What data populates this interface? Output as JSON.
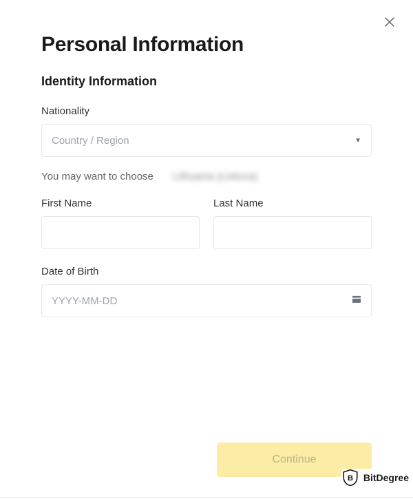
{
  "header": {
    "title": "Personal Information",
    "sectionTitle": "Identity Information"
  },
  "nationality": {
    "label": "Nationality",
    "placeholder": "Country / Region"
  },
  "hint": {
    "text": "You may want to choose",
    "suggestion": "Lithuania (Lietuva)"
  },
  "firstName": {
    "label": "First Name",
    "value": ""
  },
  "lastName": {
    "label": "Last Name",
    "value": ""
  },
  "dob": {
    "label": "Date of Birth",
    "placeholder": "YYYY-MM-DD"
  },
  "buttons": {
    "continue": "Continue"
  },
  "watermark": {
    "brand": "BitDegree"
  }
}
